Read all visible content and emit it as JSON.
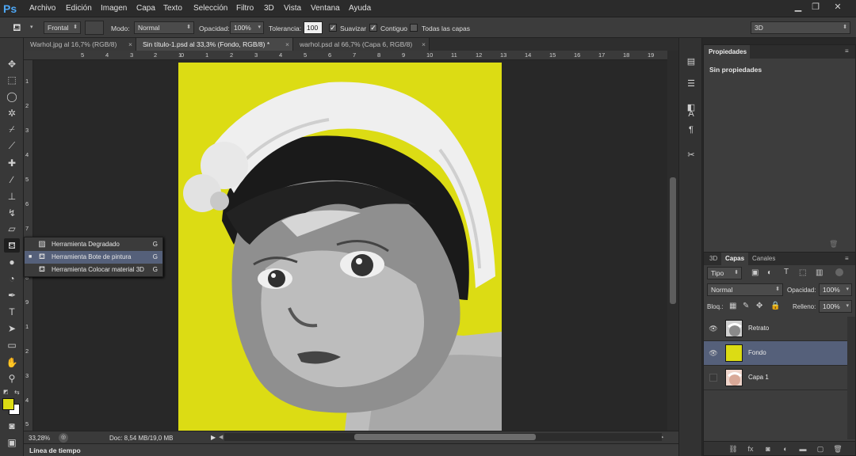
{
  "app": {
    "logo": "Ps"
  },
  "menu": [
    "Archivo",
    "Edición",
    "Imagen",
    "Capa",
    "Texto",
    "Selección",
    "Filtro",
    "3D",
    "Vista",
    "Ventana",
    "Ayuda"
  ],
  "window_controls": {
    "minimize": "▁",
    "restore": "❐",
    "close": "✕"
  },
  "options": {
    "frontal": "Frontal",
    "mode_label": "Modo:",
    "mode_value": "Normal",
    "opacity_label": "Opacidad:",
    "opacity_value": "100%",
    "tolerance_label": "Tolerancia:",
    "tolerance_value": "100",
    "smooth_label": "Suavizar",
    "contiguous_label": "Contiguo",
    "all_layers_label": "Todas las capas",
    "workspace": "3D"
  },
  "tabs": [
    {
      "label": "Warhol.jpg al 16,7% (RGB/8)"
    },
    {
      "label": "Sin título-1.psd al 33,3% (Fondo, RGB/8) *"
    },
    {
      "label": "warhol.psd al 66,7% (Capa 6, RGB/8)"
    }
  ],
  "ruler_top": [
    "5",
    "4",
    "3",
    "2",
    "1",
    "0",
    "1",
    "2",
    "3",
    "4",
    "5",
    "6",
    "7",
    "8",
    "9",
    "10",
    "11",
    "12",
    "13",
    "14",
    "15",
    "16",
    "17",
    "18",
    "19",
    "20"
  ],
  "ruler_left": [
    "1",
    "2",
    "3",
    "4",
    "5",
    "6",
    "7",
    "8",
    "9",
    "1",
    "2",
    "3",
    "4",
    "5"
  ],
  "flyout": [
    {
      "label": "Herramienta Degradado",
      "shortcut": "G"
    },
    {
      "label": "Herramienta Bote de pintura",
      "shortcut": "G"
    },
    {
      "label": "Herramienta Colocar material 3D",
      "shortcut": "G"
    }
  ],
  "status": {
    "zoom": "33,28%",
    "doc": "Doc: 8,54 MB/19,0 MB"
  },
  "timeline": {
    "label": "Línea de tiempo"
  },
  "properties": {
    "tab": "Propiedades",
    "body": "Sin propiedades"
  },
  "layers_panel": {
    "tabs": [
      "3D",
      "Capas",
      "Canales"
    ],
    "kind": "Tipo",
    "blend": "Normal",
    "opacity_label": "Opacidad:",
    "opacity_value": "100%",
    "lock_label": "Bloq.:",
    "fill_label": "Relleno:",
    "fill_value": "100%",
    "layers": [
      {
        "name": "Retrato"
      },
      {
        "name": "Fondo"
      },
      {
        "name": "Capa 1"
      }
    ]
  },
  "colors": {
    "canvas_bg": "#dcdc14",
    "foreground": "#dcdc14",
    "background": "#ffffff",
    "selection": "#55607a"
  }
}
